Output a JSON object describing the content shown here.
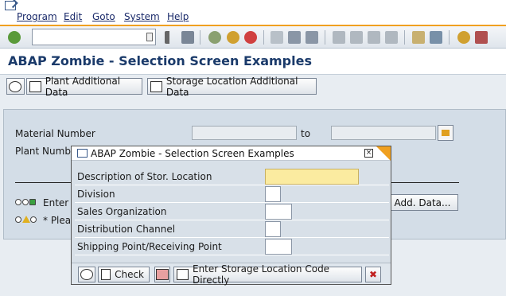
{
  "menu": {
    "items": [
      "Program",
      "Edit",
      "Goto",
      "System",
      "Help"
    ]
  },
  "toolbar": {
    "command_field": ""
  },
  "title": "ABAP Zombie - Selection Screen Examples",
  "app_toolbar": {
    "plant_button": "Plant Additional Data",
    "storage_button": "Storage Location Additional Data"
  },
  "selection": {
    "material_label": "Material Number",
    "to_label": "to",
    "plant_label": "Plant Numbe",
    "enter_text": "Enter",
    "please_text": "* Pleas",
    "add_data_button": "Add. Data..."
  },
  "popup": {
    "title": "ABAP Zombie - Selection Screen Examples",
    "close": "×",
    "fields": [
      {
        "label": "Description of Stor. Location",
        "value": ""
      },
      {
        "label": "Division",
        "value": ""
      },
      {
        "label": "Sales Organization",
        "value": ""
      },
      {
        "label": "Distribution Channel",
        "value": ""
      },
      {
        "label": "Shipping Point/Receiving Point",
        "value": ""
      }
    ],
    "check_button": "Check",
    "enter_storage_button": "Enter Storage Location Code Directly"
  },
  "colors": {
    "accent": "#f0a020",
    "title": "#1a3a6a",
    "required_field": "#fbeba0"
  }
}
